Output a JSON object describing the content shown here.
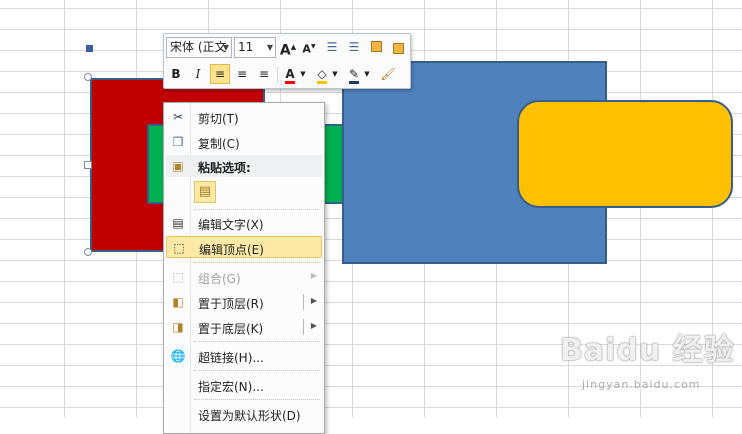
{
  "mini_toolbar": {
    "font_name": "宋体 (正文",
    "font_size": "11",
    "buttons": {
      "grow_font": "A",
      "shrink_font": "A",
      "bold": "B",
      "italic": "I",
      "font_color": "A"
    }
  },
  "context_menu": {
    "items": [
      {
        "label": "剪切(T)",
        "icon": "scissors-icon"
      },
      {
        "label": "复制(C)",
        "icon": "copy-icon"
      },
      {
        "label": "粘贴选项:",
        "icon": "clipboard-icon"
      },
      {
        "label": "编辑文字(X)",
        "icon": "edit-text-icon"
      },
      {
        "label": "编辑顶点(E)",
        "icon": "edit-points-icon",
        "highlighted": true
      },
      {
        "label": "组合(G)",
        "icon": "group-icon",
        "disabled": true
      },
      {
        "label": "置于顶层(R)",
        "icon": "bring-to-front-icon"
      },
      {
        "label": "置于底层(K)",
        "icon": "send-to-back-icon"
      },
      {
        "label": "超链接(H)...",
        "icon": "hyperlink-icon"
      },
      {
        "label": "指定宏(N)...",
        "icon": ""
      },
      {
        "label": "设置为默认形状(D)",
        "icon": ""
      }
    ]
  },
  "shapes": [
    {
      "name": "red-rectangle",
      "color": "#c00000"
    },
    {
      "name": "green-rectangle",
      "color": "#00b050"
    },
    {
      "name": "blue-rectangle",
      "color": "#4f81bd"
    },
    {
      "name": "yellow-rounded-rectangle",
      "color": "#ffc000"
    }
  ],
  "watermark": {
    "text": "Baidu 经验",
    "sub": "jingyan.baidu.com"
  }
}
